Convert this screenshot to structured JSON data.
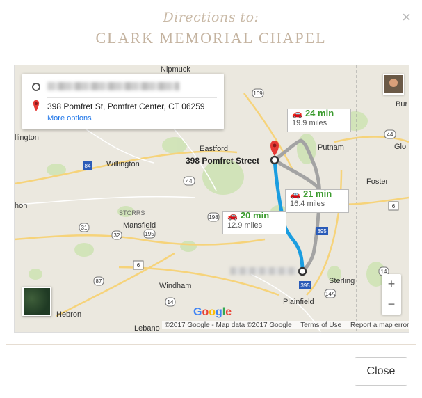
{
  "modal": {
    "subtitle": "Directions to:",
    "title": "CLARK MEMORIAL CHAPEL",
    "close_x": "×",
    "close_button": "Close"
  },
  "route": {
    "destination": "398 Pomfret St, Pomfret Center, CT 06259",
    "more_options": "More options"
  },
  "times": [
    {
      "time": "24 min",
      "distance": "19.9 miles"
    },
    {
      "time": "21 min",
      "distance": "16.4 miles"
    },
    {
      "time": "20 min",
      "distance": "12.9 miles"
    }
  ],
  "map": {
    "destination_label": "398 Pomfret Street",
    "places": {
      "nipmuck": "Nipmuck",
      "eastford": "Eastford",
      "putnam": "Putnam",
      "willington": "Willington",
      "ellington": "llington",
      "storrs": "STORRS",
      "mansfield": "Mansfield",
      "windham": "Windham",
      "hebron": "Hebron",
      "lebanon": "Lebano",
      "plainfield": "Plainfield",
      "sterling": "Sterling",
      "foster": "Foster",
      "bur": "Bur",
      "glo": "Glo",
      "hon": "hon"
    },
    "roads": [
      "169",
      "44",
      "84",
      "198",
      "44",
      "195",
      "32",
      "31",
      "6",
      "6",
      "87",
      "395",
      "395",
      "14",
      "14A",
      "6"
    ],
    "google": "Google",
    "copyright": "©2017 Google - Map data ©2017 Google",
    "terms": "Terms of Use",
    "report": "Report a map error",
    "zoom_in": "+",
    "zoom_out": "−"
  },
  "colors": {
    "accent_title": "#c4b3a0",
    "route_blue": "#1a9de0",
    "alt_route_gray": "#9e9e9e",
    "time_green": "#3a9a2d"
  }
}
